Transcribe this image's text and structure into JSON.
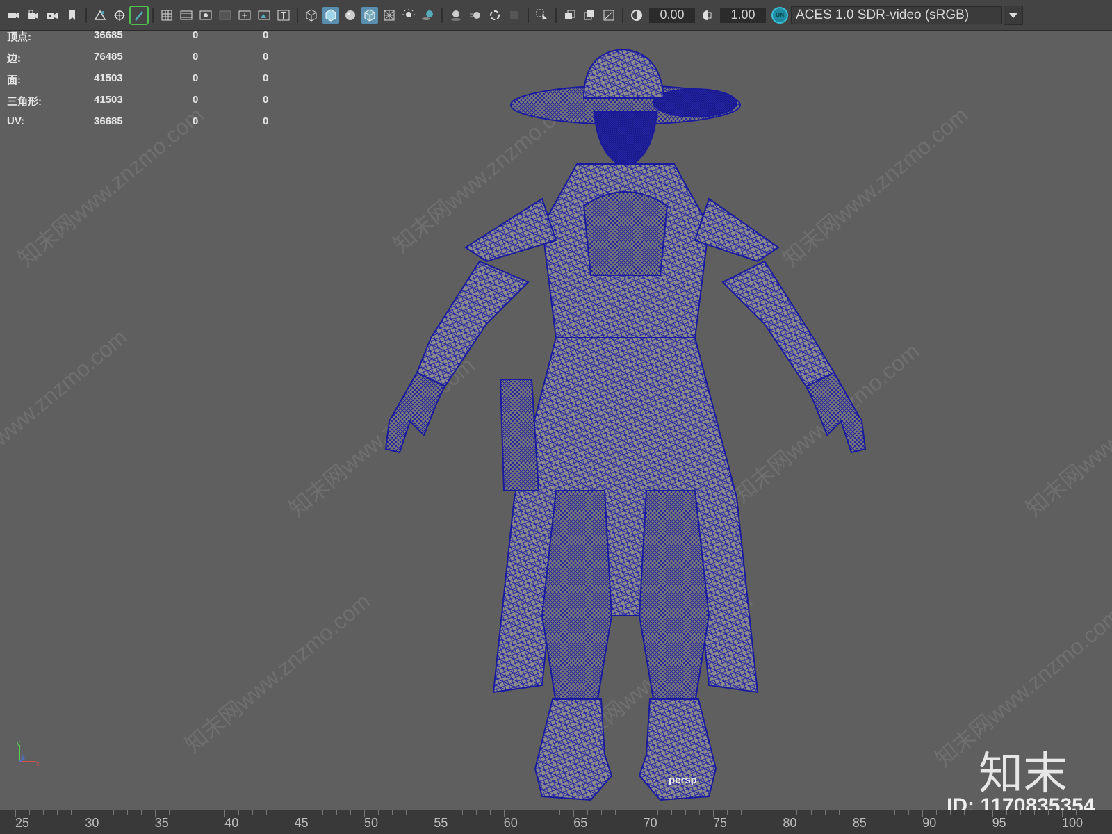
{
  "toolbar": {
    "icons": [
      "camera-icon",
      "camera-lock-icon",
      "camera-bookmark-icon",
      "bookmark-icon",
      "image-plane-icon",
      "2d-pan-icon",
      "grease-pencil-icon",
      "grid-icon",
      "film-gate-icon",
      "resolution-gate-icon",
      "gate-mask-icon",
      "field-chart-icon",
      "safe-action-icon",
      "safe-title-icon",
      "wireframe-icon",
      "smooth-shade-icon",
      "default-material-icon",
      "wireframe-on-shaded-icon",
      "textured-icon",
      "use-all-lights-icon",
      "shadows-icon",
      "screen-space-ao-icon",
      "motion-blur-icon",
      "anti-aliasing-icon",
      "depth-of-field-icon",
      "isolate-select-icon",
      "xray-icon",
      "xray-joints-icon",
      "xray-active-components-icon",
      "backface-culling-icon",
      "exposure-icon",
      "gamma-icon",
      "color-management-icon"
    ],
    "exposure_value": "0.00",
    "gamma_value": "1.00",
    "on_badge": "ON",
    "color_space": "ACES 1.0 SDR-video (sRGB)"
  },
  "hud": {
    "rows": [
      {
        "label": "顶点:",
        "v1": "36685",
        "v2": "0",
        "v3": "0"
      },
      {
        "label": "边:",
        "v1": "76485",
        "v2": "0",
        "v3": "0"
      },
      {
        "label": "面:",
        "v1": "41503",
        "v2": "0",
        "v3": "0"
      },
      {
        "label": "三角形:",
        "v1": "41503",
        "v2": "0",
        "v3": "0"
      },
      {
        "label": "UV:",
        "v1": "36685",
        "v2": "0",
        "v3": "0"
      }
    ]
  },
  "viewport": {
    "camera": "persp",
    "wireframe_color": "#1a1a9e",
    "shaded_color": "#8a8a8a"
  },
  "axis": {
    "y": "y",
    "z": "z",
    "x": "x"
  },
  "watermark": {
    "text": "知末网www.znzmo.com",
    "logo": "知末",
    "id": "ID: 1170835354"
  },
  "ruler": {
    "ticks": [
      "25",
      "30",
      "35",
      "40",
      "45",
      "50",
      "55",
      "60",
      "65",
      "70",
      "75",
      "80",
      "85",
      "90",
      "95",
      "100"
    ]
  }
}
